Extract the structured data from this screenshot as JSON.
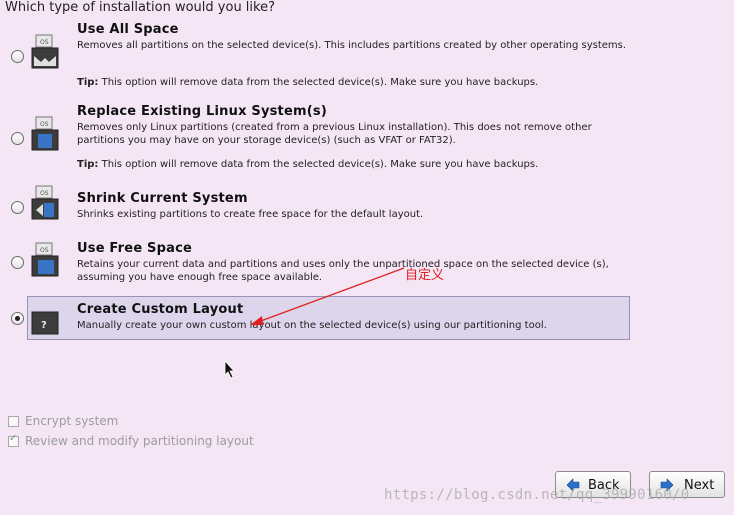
{
  "heading": "Which type of installation would you like?",
  "options": [
    {
      "title": "Use All Space",
      "desc": "Removes all partitions on the selected device(s).  This includes partitions created by other operating systems.",
      "tip_label": "Tip:",
      "tip_text": " This option will remove data from the selected device(s).  Make sure you have backups.",
      "selected": false,
      "icon": "disk-full-icon"
    },
    {
      "title": "Replace Existing Linux System(s)",
      "desc": "Removes only Linux partitions (created from a previous Linux installation).  This does not remove other partitions you may have on your storage device(s) (such as VFAT or FAT32).",
      "tip_label": "Tip:",
      "tip_text": " This option will remove data from the selected device(s).  Make sure you have backups.",
      "selected": false,
      "icon": "disk-replace-icon"
    },
    {
      "title": "Shrink Current System",
      "desc": "Shrinks existing partitions to create free space for the default layout.",
      "selected": false,
      "icon": "disk-shrink-icon"
    },
    {
      "title": "Use Free Space",
      "desc": "Retains your current data and partitions and uses only the unpartitioned space on the selected device (s), assuming you have enough free space available.",
      "selected": false,
      "icon": "disk-free-icon"
    },
    {
      "title": "Create Custom Layout",
      "desc": "Manually create your own custom layout on the selected device(s) using our partitioning tool.",
      "selected": true,
      "icon": "disk-custom-icon",
      "icon_glyph": "?"
    }
  ],
  "checkboxes": [
    {
      "label": "Encrypt system",
      "checked": false
    },
    {
      "label": "Review and modify partitioning layout",
      "checked": true
    }
  ],
  "buttons": {
    "back": "Back",
    "next": "Next"
  },
  "annotation": "自定义",
  "watermark": "https://blog.csdn.net/qq_39990160/0",
  "colors": {
    "background": "#f5e6f5",
    "selected_bg": "#dcd5ec",
    "annotation": "#e02020"
  }
}
